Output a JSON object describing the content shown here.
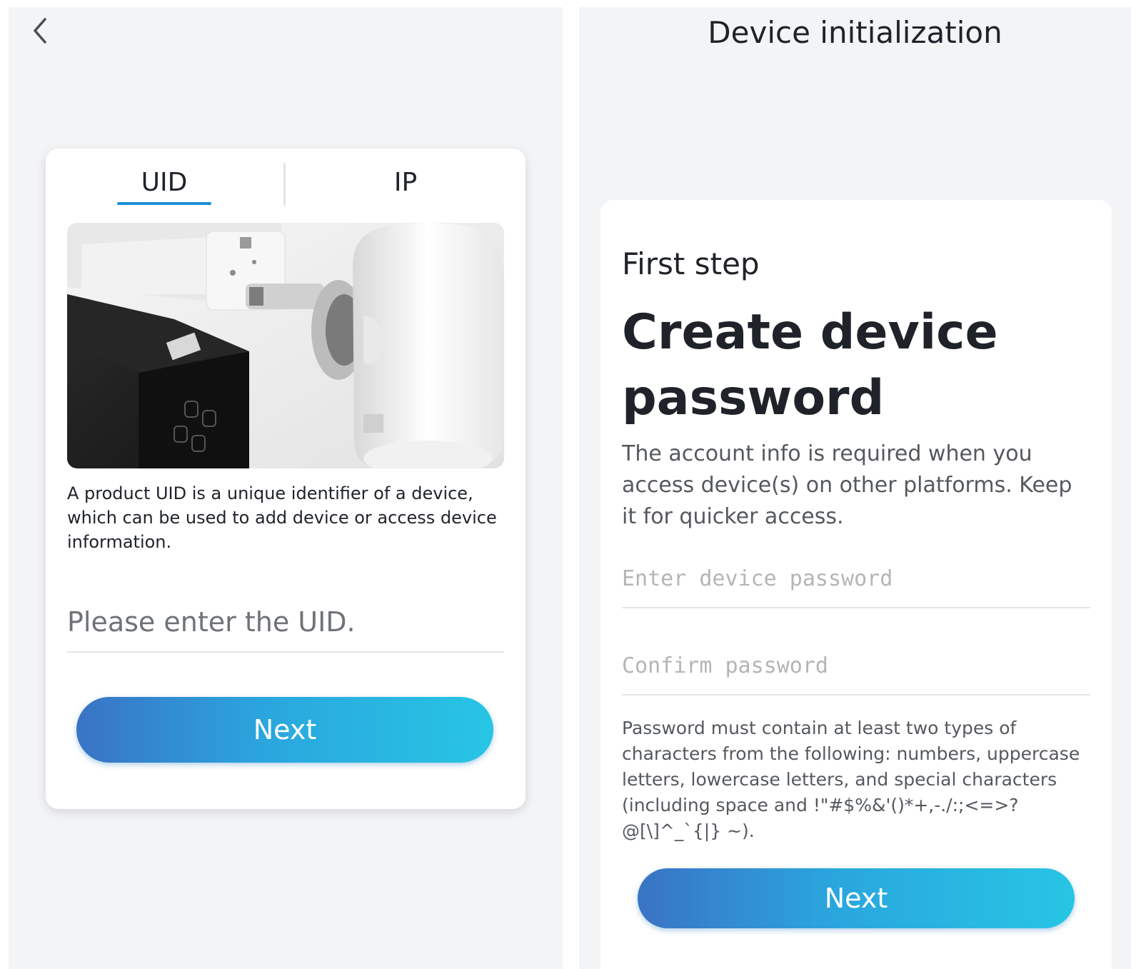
{
  "left_screen": {
    "back_icon": "chevron-left-icon",
    "tabs": [
      {
        "label": "UID",
        "active": true
      },
      {
        "label": "IP",
        "active": false
      }
    ],
    "description": "A product UID is a unique identifier of a device, which can be used to add device or access device information.",
    "uid_input": {
      "placeholder": "Please enter the UID.",
      "value": ""
    },
    "next_label": "Next"
  },
  "right_screen": {
    "title": "Device initialization",
    "step_label": "First step",
    "heading": "Create device password",
    "account_info": "The account info is required when you access device(s) on other platforms. Keep it for quicker access.",
    "password_input": {
      "placeholder": "Enter device password",
      "value": ""
    },
    "confirm_input": {
      "placeholder": "Confirm password",
      "value": ""
    },
    "rules": "Password must contain at least two types of characters from the following: numbers, uppercase letters, lowercase letters, and special characters (including space and !\"#$%&'()*+,-./:;<=>?@[\\]^_`{|} ~).",
    "next_label": "Next"
  },
  "colors": {
    "accent": "#1a8fd8",
    "button_gradient_start": "#3a73c4",
    "button_gradient_end": "#27c5e4",
    "background": "#f3f4f6",
    "card": "#ffffff"
  }
}
